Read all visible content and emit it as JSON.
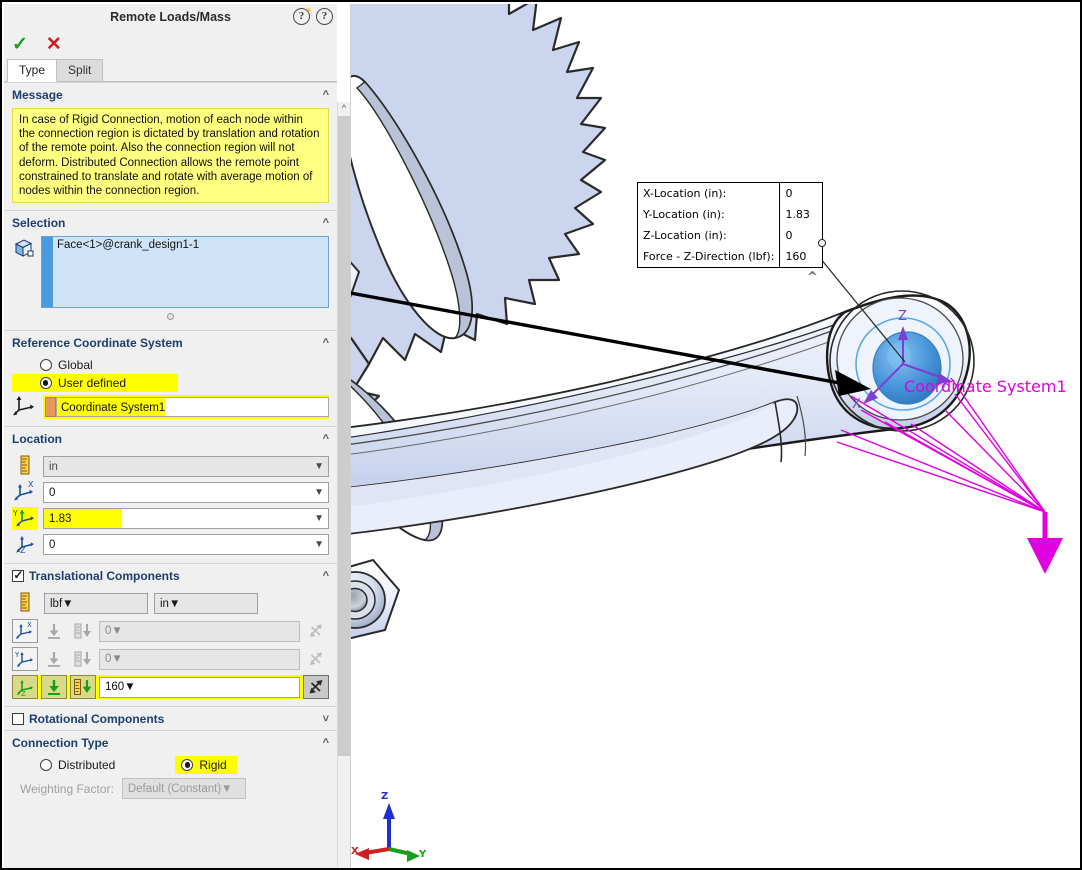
{
  "panel": {
    "title": "Remote Loads/Mass",
    "accept_icon": "check-icon",
    "cancel_icon": "close-icon",
    "help_icon": "help-icon",
    "help_whatsnew_icon": "help-whatsnew-icon",
    "tabs": [
      {
        "label": "Type",
        "active": true
      },
      {
        "label": "Split",
        "active": false
      }
    ],
    "message": {
      "header": "Message",
      "text": "In case of Rigid Connection, motion of each node within the connection region is dictated by translation and rotation of the remote point. Also the connection region will not deform. Distributed Connection allows the remote point constrained to translate and rotate with average motion of nodes within the connection region.",
      "highlight_color": "#ffff80"
    },
    "selection": {
      "header": "Selection",
      "icon": "face-select-icon",
      "items": [
        "Face<1>@crank_design1-1"
      ]
    },
    "reference_cs": {
      "header": "Reference Coordinate System",
      "options": [
        {
          "label": "Global",
          "selected": false,
          "highlighted": false
        },
        {
          "label": "User defined",
          "selected": true,
          "highlighted": true
        }
      ],
      "icon": "coordinate-system-icon",
      "value": "Coordinate System1",
      "highlighted": true
    },
    "location": {
      "header": "Location",
      "unit": "in",
      "unit_icon": "ruler-icon",
      "fields": [
        {
          "axis": "X",
          "icon": "axis-x-icon",
          "value": "0",
          "highlighted": false
        },
        {
          "axis": "Y",
          "icon": "axis-y-icon",
          "value": "1.83",
          "highlighted": true
        },
        {
          "axis": "Z",
          "icon": "axis-z-icon",
          "value": "0",
          "highlighted": false
        }
      ]
    },
    "translational": {
      "header": "Translational Components",
      "checked": true,
      "force_unit": "lbf",
      "length_unit": "in",
      "unit_icon": "ruler-icon",
      "rows": [
        {
          "axis": "X",
          "icon": "axis-x-icon",
          "value": "0",
          "enabled": false,
          "highlighted": false,
          "reverse_pressed": false
        },
        {
          "axis": "Y",
          "icon": "axis-y-icon",
          "value": "0",
          "enabled": false,
          "highlighted": false,
          "reverse_pressed": false
        },
        {
          "axis": "Z",
          "icon": "axis-z-icon",
          "value": "160",
          "enabled": true,
          "highlighted": true,
          "reverse_pressed": true
        }
      ]
    },
    "rotational": {
      "header": "Rotational Components",
      "checked": false
    },
    "connection": {
      "header": "Connection Type",
      "options": [
        {
          "label": "Distributed",
          "selected": false,
          "highlighted": false
        },
        {
          "label": "Rigid",
          "selected": true,
          "highlighted": true
        }
      ],
      "weighting_label": "Weighting Factor:",
      "weighting_value": "Default (Constant)",
      "weighting_enabled": false
    }
  },
  "viewport": {
    "callout": {
      "rows": [
        {
          "label": "X-Location (in):",
          "value": "0"
        },
        {
          "label": "Y-Location (in):",
          "value": "1.83"
        },
        {
          "label": "Z-Location (in):",
          "value": "0"
        },
        {
          "label": "Force -  Z-Direction (lbf):",
          "value": "160"
        }
      ]
    },
    "coordinate_system_label": "Coordinate System1",
    "coordinate_system_color": "#e000e0",
    "axis_labels": [
      {
        "name": "Z",
        "text": "Z"
      },
      {
        "name": "X",
        "text": "X"
      }
    ],
    "triad": [
      {
        "name": "Z",
        "text": "Z",
        "color": "#2030d0"
      },
      {
        "name": "X",
        "text": "X",
        "color": "#d02020"
      },
      {
        "name": "Y",
        "text": "Y",
        "color": "#17a017"
      }
    ],
    "force_arrow_color": "#e000e0",
    "model_color": "#ccd5ee"
  }
}
